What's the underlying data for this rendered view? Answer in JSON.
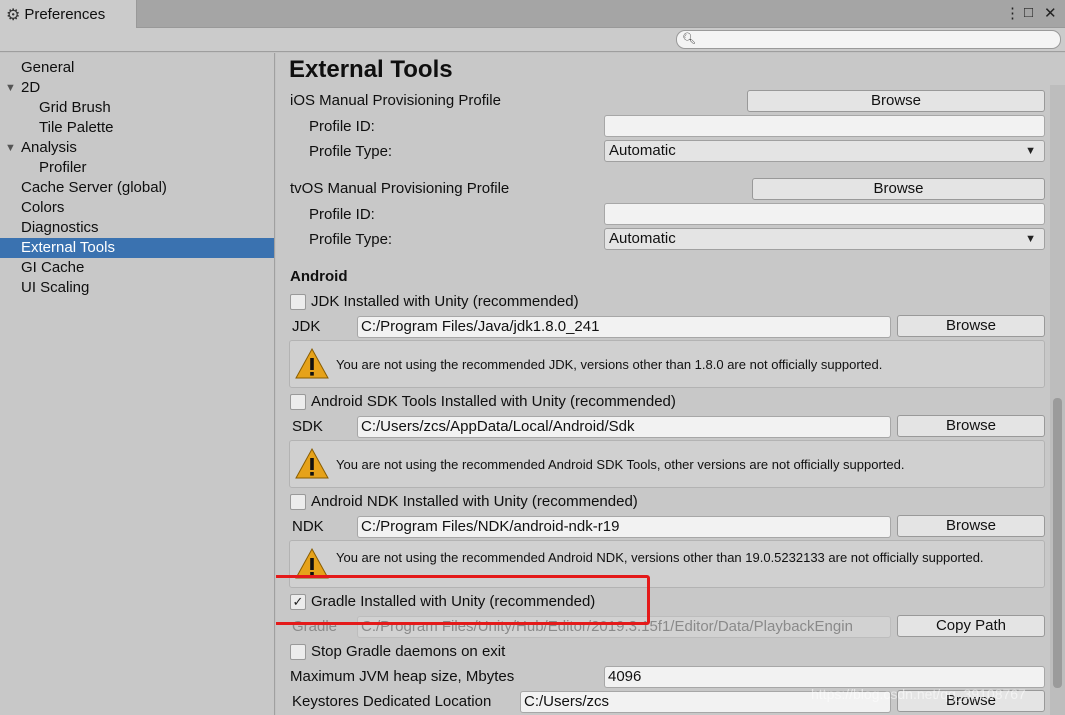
{
  "window": {
    "tab_title": "Preferences",
    "tab_icon": "gear-icon",
    "menu_icon": "⋮",
    "maximize_icon": "□",
    "close_icon": "✕"
  },
  "search": {
    "value": "",
    "placeholder": ""
  },
  "sidebar": {
    "items": [
      {
        "label": "General",
        "level": 0,
        "foldout": false,
        "selected": false
      },
      {
        "label": "2D",
        "level": 0,
        "foldout": true,
        "selected": false
      },
      {
        "label": "Grid Brush",
        "level": 1,
        "foldout": false,
        "selected": false
      },
      {
        "label": "Tile Palette",
        "level": 1,
        "foldout": false,
        "selected": false
      },
      {
        "label": "Analysis",
        "level": 0,
        "foldout": true,
        "selected": false
      },
      {
        "label": "Profiler",
        "level": 1,
        "foldout": false,
        "selected": false
      },
      {
        "label": "Cache Server (global)",
        "level": 0,
        "foldout": false,
        "selected": false
      },
      {
        "label": "Colors",
        "level": 0,
        "foldout": false,
        "selected": false
      },
      {
        "label": "Diagnostics",
        "level": 0,
        "foldout": false,
        "selected": false
      },
      {
        "label": "External Tools",
        "level": 0,
        "foldout": false,
        "selected": true
      },
      {
        "label": "GI Cache",
        "level": 0,
        "foldout": false,
        "selected": false
      },
      {
        "label": "UI Scaling",
        "level": 0,
        "foldout": false,
        "selected": false
      }
    ]
  },
  "main": {
    "title": "External Tools",
    "ios": {
      "label": "iOS Manual Provisioning Profile",
      "browse": "Browse",
      "profile_id_label": "Profile ID:",
      "profile_id_value": "",
      "profile_type_label": "Profile Type:",
      "profile_type_value": "Automatic"
    },
    "tvos": {
      "label": "tvOS Manual Provisioning Profile",
      "browse": "Browse",
      "profile_id_label": "Profile ID:",
      "profile_id_value": "",
      "profile_type_label": "Profile Type:",
      "profile_type_value": "Automatic"
    },
    "android": {
      "heading": "Android",
      "jdk": {
        "checkbox_label": "JDK Installed with Unity (recommended)",
        "checked": false,
        "field_label": "JDK",
        "path": "C:/Program Files/Java/jdk1.8.0_241",
        "browse": "Browse",
        "warning": "You are not using the recommended JDK, versions other than 1.8.0 are not officially supported."
      },
      "sdk": {
        "checkbox_label": "Android SDK Tools Installed with Unity (recommended)",
        "checked": false,
        "field_label": "SDK",
        "path": "C:/Users/zcs/AppData/Local/Android/Sdk",
        "browse": "Browse",
        "warning": "You are not using the recommended Android SDK Tools, other versions are not officially supported."
      },
      "ndk": {
        "checkbox_label": "Android NDK Installed with Unity (recommended)",
        "checked": false,
        "field_label": "NDK",
        "path": "C:/Program Files/NDK/android-ndk-r19",
        "browse": "Browse",
        "warning": "You are not using the recommended Android NDK, versions other than 19.0.5232133 are not officially supported."
      },
      "gradle": {
        "checkbox_label": "Gradle Installed with Unity (recommended)",
        "checked": true,
        "check_mark": "✓",
        "field_label": "Gradle",
        "path": "C:/Program Files/Unity/Hub/Editor/2019.3.15f1/Editor/Data/PlaybackEngin",
        "copy_path": "Copy Path"
      },
      "stop_gradle": {
        "label": "Stop Gradle daemons on exit",
        "checked": false
      },
      "jvm_heap": {
        "label": "Maximum JVM heap size, Mbytes",
        "value": "4096"
      },
      "keystores": {
        "label": "Keystores Dedicated Location",
        "value": "C:/Users/zcs",
        "browse": "Browse"
      }
    }
  },
  "colors": {
    "selection": "#3a72b0",
    "highlight_annotation": "#e41a1a",
    "warning_triangle": "#e6a21a"
  },
  "watermark": "https://blog.csdn.net/qq_39108767"
}
